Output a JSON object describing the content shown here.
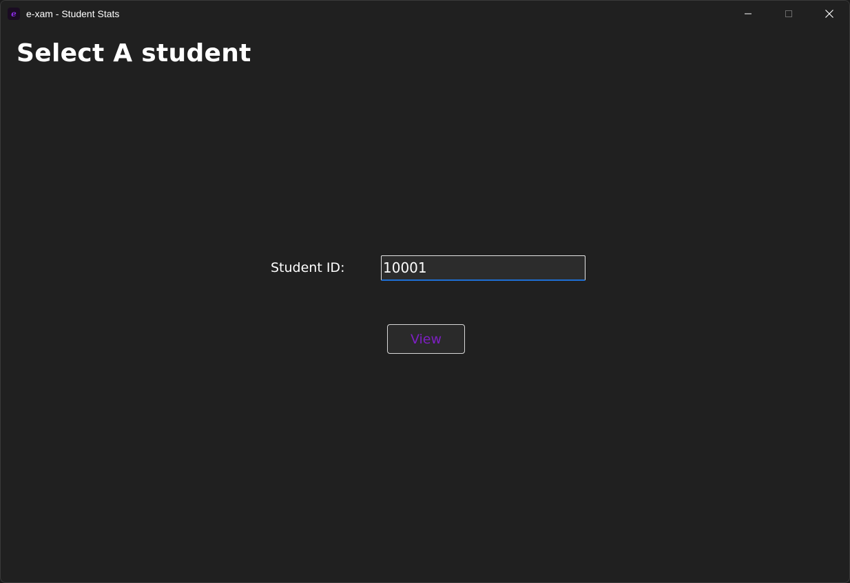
{
  "window": {
    "title": "e-xam - Student Stats",
    "app_icon_glyph": "e",
    "accent_color": "#8a2be2"
  },
  "page": {
    "heading": "Select A student"
  },
  "form": {
    "student_id_label": "Student ID:",
    "student_id_value": "10001",
    "view_button_label": "View",
    "view_button_color": "#7d1fc2",
    "input_focus_color": "#1e6fd6"
  },
  "icons": {
    "minimize": "minimize-icon",
    "maximize": "maximize-icon",
    "close": "close-icon"
  }
}
